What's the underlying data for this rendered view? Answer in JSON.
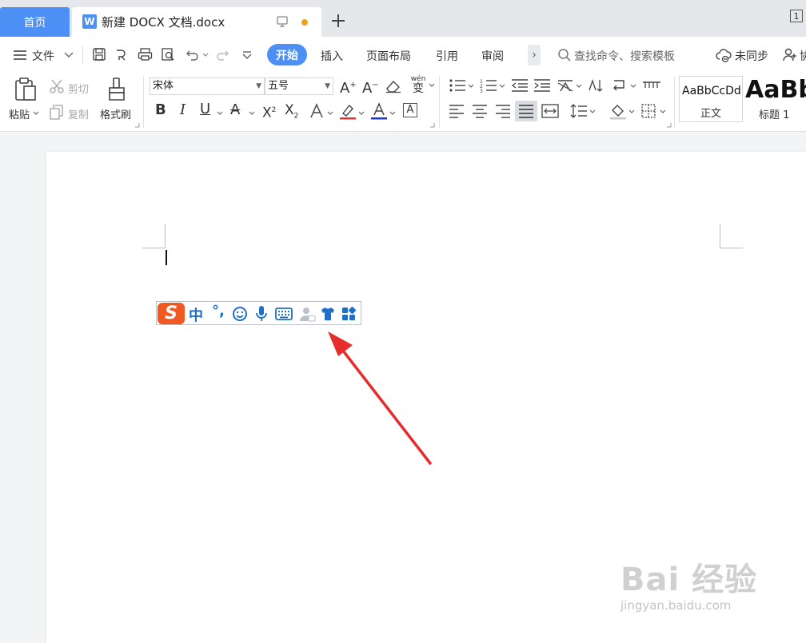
{
  "tabs": {
    "home": "首页",
    "doc_icon": "W",
    "doc_title": "新建 DOCX 文档.docx",
    "window_number": "1"
  },
  "menubar": {
    "file": "文件",
    "start": "开始",
    "items": [
      "插入",
      "页面布局",
      "引用",
      "审阅"
    ],
    "search_placeholder": "查找命令、搜索模板",
    "sync": "未同步",
    "collab": "协"
  },
  "ribbon": {
    "paste": "粘贴",
    "cut": "剪切",
    "copy": "复制",
    "format_painter": "格式刷",
    "font_name": "宋体",
    "font_size": "五号",
    "pinyin": "wén",
    "pinyin_char": "变",
    "styles": [
      {
        "preview": "AaBbCcDd",
        "name": "正文"
      },
      {
        "preview": "AaBb",
        "name": "标题 1"
      }
    ]
  },
  "ime": {
    "logo": "S",
    "mode": "中",
    "punct": "°,"
  },
  "watermark": {
    "main": "Bai 经验",
    "sub": "jingyan.baidu.com"
  },
  "colors": {
    "accent": "#4c8ff5",
    "font_color_underline": "#1a36e0",
    "highlight_underline": "#e4342e",
    "arrow": "#e52d2d",
    "ime_logo": "#f05a22",
    "ime_icons": "#1f6fc6"
  }
}
